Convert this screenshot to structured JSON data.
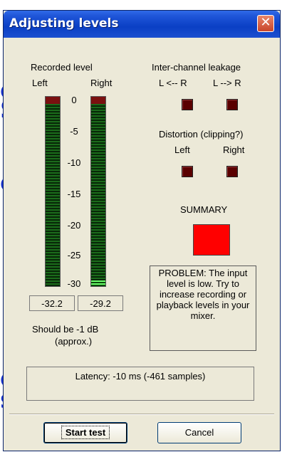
{
  "background": {
    "fragments": [
      "e",
      "S",
      "e",
      "e",
      "s"
    ]
  },
  "window": {
    "title": "Adjusting levels",
    "close_glyph": "✕",
    "colors": {
      "titlebar": "#0a3fc4",
      "summary_led": "#ff0000",
      "meter_lit": "#6cff6c"
    }
  },
  "recorded": {
    "heading": "Recorded level",
    "left_label": "Left",
    "right_label": "Right",
    "scale": [
      "0",
      "-5",
      "-10",
      "-15",
      "-20",
      "-25",
      "-30"
    ],
    "left_value": "-32.2",
    "right_value": "-29.2",
    "left_fill_fraction": 0.0,
    "right_fill_fraction": 0.03,
    "should_be_line1": "Should be  -1 dB",
    "should_be_line2": "(approx.)"
  },
  "leakage": {
    "heading": "Inter-channel leakage",
    "left_label": "L <-- R",
    "right_label": "L --> R"
  },
  "distortion": {
    "heading": "Distortion (clipping?)",
    "left_label": "Left",
    "right_label": "Right"
  },
  "summary": {
    "heading": "SUMMARY",
    "message": "PROBLEM: The input level is low. Try to increase recording or playback levels in your mixer."
  },
  "latency": "Latency: -10 ms (-461 samples)",
  "buttons": {
    "start": "Start test",
    "cancel": "Cancel"
  }
}
